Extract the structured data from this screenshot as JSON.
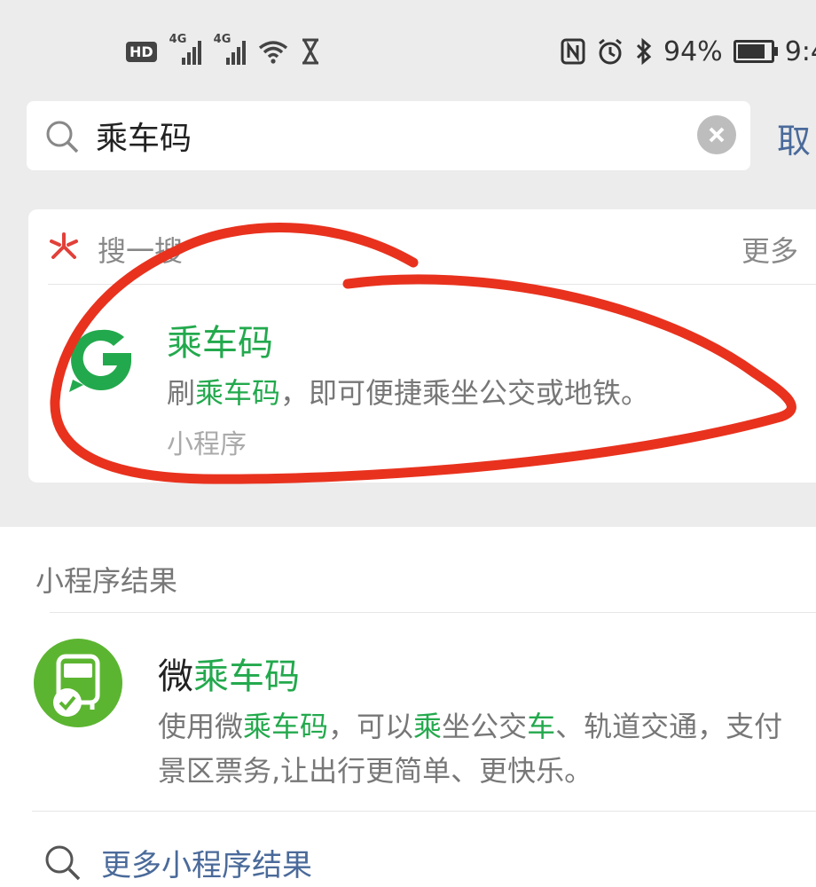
{
  "status_bar": {
    "hd_label": "HD",
    "net1": "4G",
    "net2": "4G",
    "battery_text": "94%",
    "time": "9:4"
  },
  "search": {
    "query": "乘车码",
    "cancel_label": "取"
  },
  "sou_card": {
    "title": "搜一搜",
    "more_label": "更多",
    "result": {
      "title": "乘车码",
      "desc_prefix": "刷",
      "desc_highlight": "乘车码",
      "desc_suffix": "，即可便捷乘坐公交或地铁。",
      "type_label": "小程序"
    }
  },
  "mini_program_results": {
    "section_title": "小程序结果",
    "item": {
      "title_prefix": "微",
      "title_highlight": "乘车码",
      "desc_line1": {
        "p1": "使用微",
        "h1": "乘车码",
        "p2": "，可以",
        "h2": "乘",
        "p3": "坐公交",
        "h3": "车",
        "p4": "、轨道交通，支付"
      },
      "desc_line2": "景区票务,让出行更简单、更快乐。"
    },
    "more_results_label": "更多小程序结果"
  },
  "colors": {
    "highlight_green": "#23a94d",
    "link_blue": "#4a6a9a",
    "annotation_red": "#e8321e"
  }
}
